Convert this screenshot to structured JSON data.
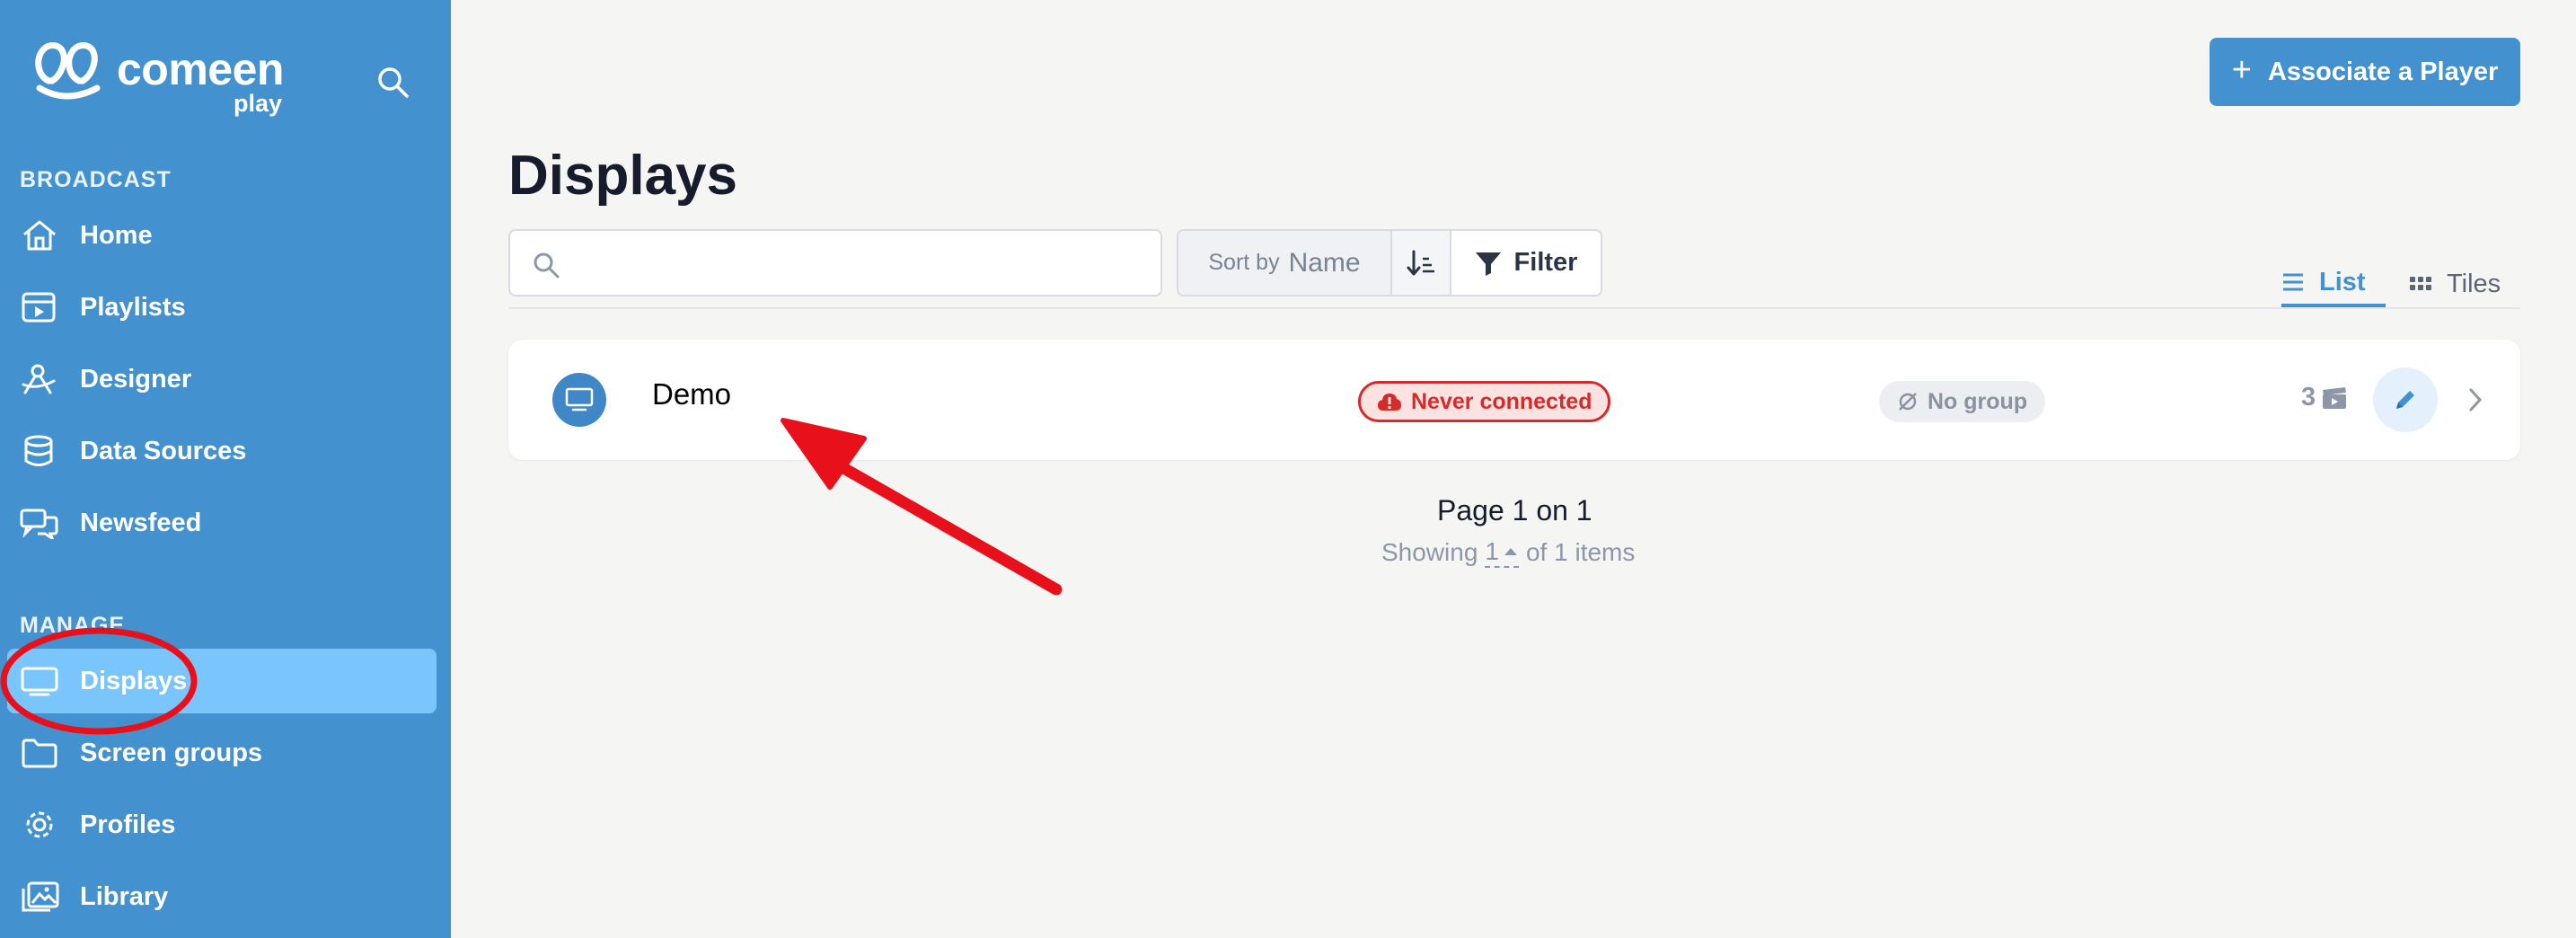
{
  "brand": {
    "name": "comeen",
    "sub": "play"
  },
  "sidebar": {
    "sections": [
      {
        "label": "BROADCAST"
      },
      {
        "label": "MANAGE"
      }
    ],
    "items": [
      {
        "label": "Home",
        "icon": "home-icon"
      },
      {
        "label": "Playlists",
        "icon": "playlist-icon"
      },
      {
        "label": "Designer",
        "icon": "designer-icon"
      },
      {
        "label": "Data Sources",
        "icon": "database-icon"
      },
      {
        "label": "Newsfeed",
        "icon": "chat-icon"
      },
      {
        "label": "Displays",
        "icon": "monitor-icon",
        "active": true
      },
      {
        "label": "Screen groups",
        "icon": "folder-icon"
      },
      {
        "label": "Profiles",
        "icon": "gear-icon"
      },
      {
        "label": "Library",
        "icon": "images-icon"
      }
    ]
  },
  "header": {
    "associate_label": "Associate a Player"
  },
  "page": {
    "title": "Displays"
  },
  "toolbar": {
    "search_placeholder": "",
    "sort_by_label": "Sort by",
    "sort_field": "Name",
    "filter_label": "Filter",
    "views": [
      {
        "label": "List",
        "active": true
      },
      {
        "label": "Tiles"
      }
    ]
  },
  "displays": [
    {
      "name": "Demo",
      "status": "Never connected",
      "group": "No group",
      "count": "3"
    }
  ],
  "pagination": {
    "title": "Page 1 on 1",
    "showing": "Showing",
    "page_size": "1",
    "of_items": "of 1 items"
  },
  "colors": {
    "accent": "#4391cf",
    "active_nav": "#7ac5fb",
    "error": "#d62b2b",
    "annotation": "#e8101a"
  }
}
